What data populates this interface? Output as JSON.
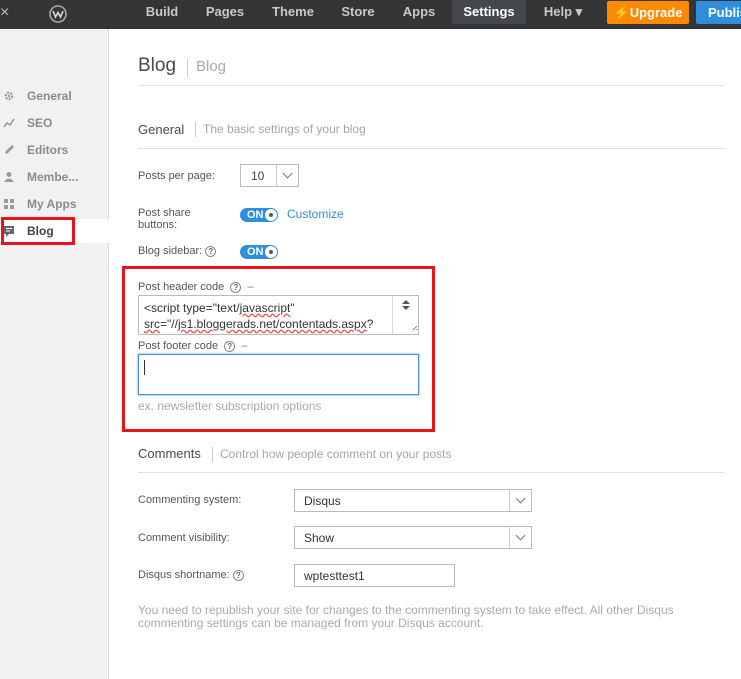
{
  "topbar": {
    "close_glyph": "×",
    "logo_icon": "weebly-logo",
    "nav": [
      "Build",
      "Pages",
      "Theme",
      "Store",
      "Apps",
      "Settings",
      "Help ▾"
    ],
    "active_nav": "Settings",
    "upgrade_label": "⚡Upgrade",
    "publish_label": "Publis"
  },
  "sidebar": {
    "items": [
      {
        "label": "General",
        "icon": "gear-icon"
      },
      {
        "label": "SEO",
        "icon": "chart-icon"
      },
      {
        "label": "Editors",
        "icon": "pencil-icon"
      },
      {
        "label": "Membe...",
        "icon": "user-icon"
      },
      {
        "label": "My Apps",
        "icon": "apps-icon"
      },
      {
        "label": "Blog",
        "icon": "blog-icon"
      }
    ],
    "active": "Blog",
    "highlight_color": "#e8141c"
  },
  "page": {
    "title": "Blog",
    "subtitle": "Blog"
  },
  "general": {
    "title": "General",
    "subtitle": "The basic settings of your blog",
    "posts_per_page_label": "Posts per page:",
    "posts_per_page_value": "10",
    "share_label_1": "Post share",
    "share_label_2": "buttons:",
    "share_toggle": "ON",
    "customize_link": "Customize",
    "sidebar_label": "Blog sidebar:",
    "sidebar_toggle": "ON",
    "help_glyph": "?",
    "header_code_label": "Post header code",
    "header_code_line1_pre": "<script type=\"text/",
    "header_code_line1_sq": "javascript",
    "header_code_line1_post": "\"",
    "header_code_line2_sq1": "src",
    "header_code_line2_mid": "=\"//",
    "header_code_line2_sq2": "js1.bloggerads.net/contentads.aspx",
    "header_code_line2_post": "?",
    "footer_code_label": "Post footer code",
    "footer_hint": "ex. newsletter subscription options",
    "dash": "–"
  },
  "comments": {
    "title": "Comments",
    "subtitle": "Control how people comment on your posts",
    "system_label": "Commenting system:",
    "system_value": "Disqus",
    "visibility_label": "Comment visibility:",
    "visibility_value": "Show",
    "shortname_label": "Disqus shortname:",
    "shortname_value": "wptesttest1",
    "note": "You need to republish your site for changes to the commenting system to take effect. All other Disqus commenting settings can be managed from your Disqus account."
  },
  "colors": {
    "accent": "#2f8fdd",
    "upgrade": "#ff8a00",
    "highlight": "#e8141c"
  }
}
